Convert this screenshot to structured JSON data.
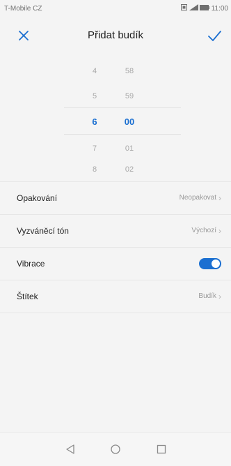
{
  "status_bar": {
    "carrier": "T-Mobile CZ",
    "time": "11:00",
    "icons": [
      "sim-icon",
      "signal-icon",
      "battery-icon"
    ]
  },
  "header": {
    "title": "Přidat budík",
    "close_icon": "close-icon",
    "confirm_icon": "check-icon"
  },
  "time_picker": {
    "hours": [
      "4",
      "5",
      "6",
      "7",
      "8"
    ],
    "minutes": [
      "58",
      "59",
      "00",
      "01",
      "02"
    ],
    "selected_hour": "6",
    "selected_minute": "00"
  },
  "settings": [
    {
      "label": "Opakování",
      "value": "Neopakovat"
    },
    {
      "label": "Vyzváněcí tón",
      "value": "Výchozí"
    },
    {
      "label": "Vibrace",
      "toggle_on": true
    },
    {
      "label": "Štítek",
      "value": "Budík"
    }
  ],
  "nav_bar": {
    "icons": [
      "back-icon",
      "home-icon",
      "recents-icon"
    ]
  },
  "colors": {
    "accent": "#1b6fd1",
    "background": "#f4f4f4"
  }
}
